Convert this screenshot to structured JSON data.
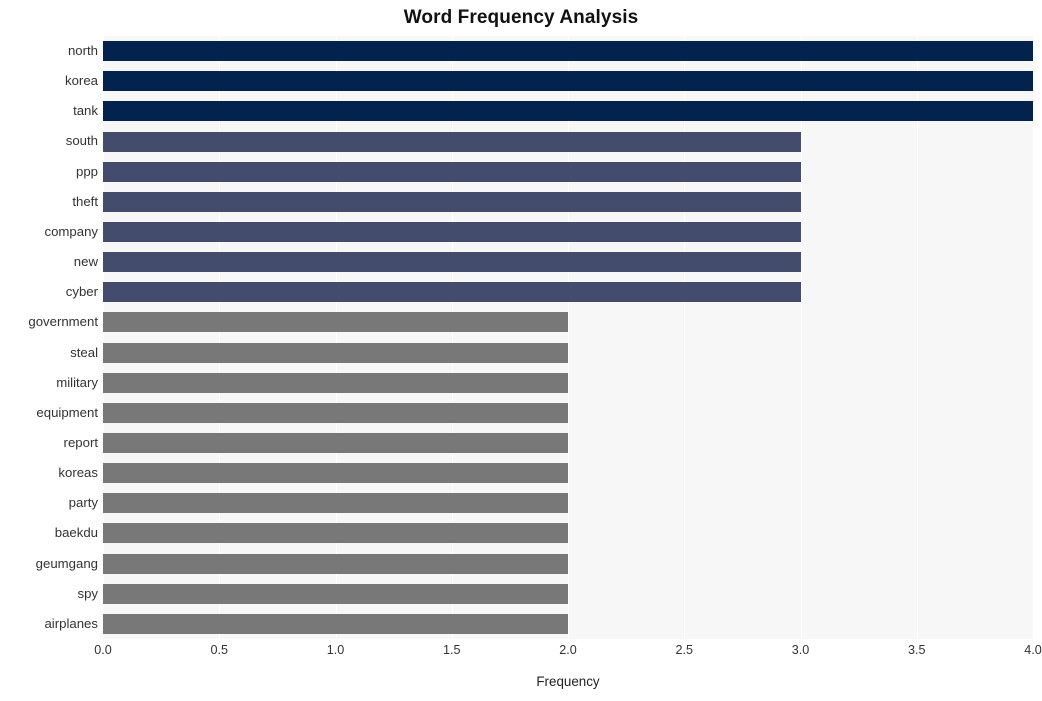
{
  "chart_data": {
    "type": "bar",
    "orientation": "horizontal",
    "title": "Word Frequency Analysis",
    "xlabel": "Frequency",
    "ylabel": "",
    "xlim": [
      0.0,
      4.0
    ],
    "xticks": [
      "0.0",
      "0.5",
      "1.0",
      "1.5",
      "2.0",
      "2.5",
      "3.0",
      "3.5",
      "4.0"
    ],
    "xtick_values": [
      0.0,
      0.5,
      1.0,
      1.5,
      2.0,
      2.5,
      3.0,
      3.5,
      4.0
    ],
    "grid": true,
    "grid_color": "#ffffff",
    "plot_background": "#f7f7f8",
    "figure_background": "#ffffff",
    "legend": null,
    "categories": [
      "north",
      "korea",
      "tank",
      "south",
      "ppp",
      "theft",
      "company",
      "new",
      "cyber",
      "government",
      "steal",
      "military",
      "equipment",
      "report",
      "koreas",
      "party",
      "baekdu",
      "geumgang",
      "spy",
      "airplanes"
    ],
    "values": [
      4,
      4,
      4,
      3,
      3,
      3,
      3,
      3,
      3,
      2,
      2,
      2,
      2,
      2,
      2,
      2,
      2,
      2,
      2,
      2
    ],
    "bar_colors": [
      "#02234d",
      "#02234d",
      "#02234d",
      "#434c6c",
      "#434c6c",
      "#434c6c",
      "#434c6c",
      "#434c6c",
      "#434c6c",
      "#787878",
      "#787878",
      "#787878",
      "#787878",
      "#787878",
      "#787878",
      "#787878",
      "#787878",
      "#787878",
      "#787878",
      "#787878"
    ],
    "palette": {
      "high": "#02234d",
      "medium": "#434c6c",
      "low": "#787878"
    }
  }
}
